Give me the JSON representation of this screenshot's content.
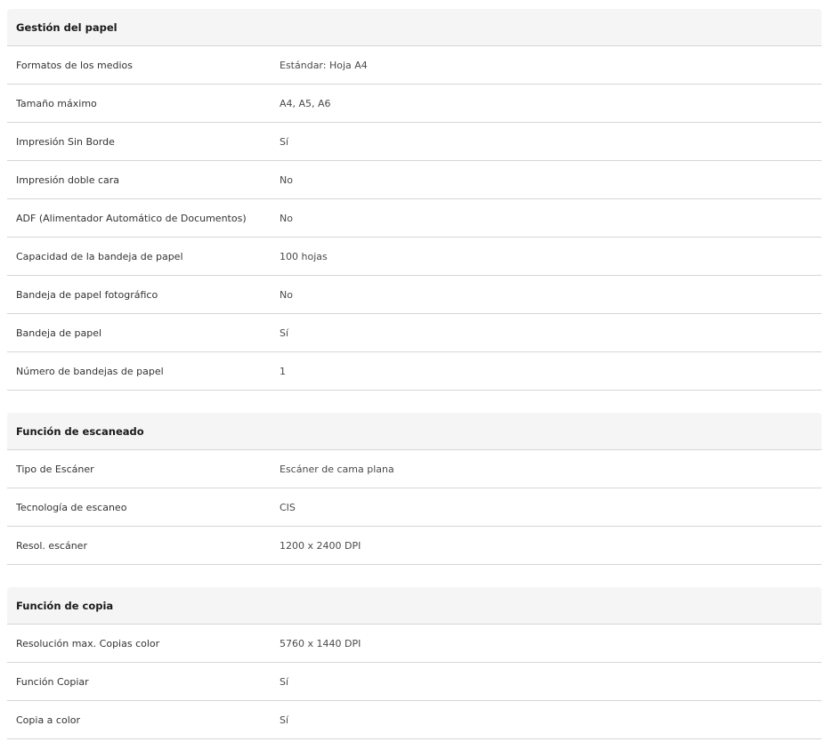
{
  "sections": [
    {
      "title": "Gestión del papel",
      "rows": [
        {
          "label": "Formatos de los medios",
          "value": "Estándar: Hoja A4"
        },
        {
          "label": "Tamaño máximo",
          "value": "A4, A5, A6"
        },
        {
          "label": "Impresión Sin Borde",
          "value": "Sí"
        },
        {
          "label": "Impresión doble cara",
          "value": "No"
        },
        {
          "label": "ADF (Alimentador Automático de Documentos)",
          "value": "No"
        },
        {
          "label": "Capacidad de la bandeja de papel",
          "value": "100 hojas"
        },
        {
          "label": "Bandeja de papel fotográfico",
          "value": "No"
        },
        {
          "label": "Bandeja de papel",
          "value": "Sí"
        },
        {
          "label": "Número de bandejas de papel",
          "value": "1"
        }
      ]
    },
    {
      "title": "Función de escaneado",
      "rows": [
        {
          "label": "Tipo de Escáner",
          "value": "Escáner de cama plana"
        },
        {
          "label": "Tecnología de escaneo",
          "value": "CIS"
        },
        {
          "label": "Resol. escáner",
          "value": "1200 x 2400 DPI"
        }
      ]
    },
    {
      "title": "Función de copia",
      "rows": [
        {
          "label": "Resolución max. Copias color",
          "value": "5760 x 1440 DPI"
        },
        {
          "label": "Función Copiar",
          "value": "Sí"
        },
        {
          "label": "Copia a color",
          "value": "Sí"
        }
      ]
    }
  ]
}
